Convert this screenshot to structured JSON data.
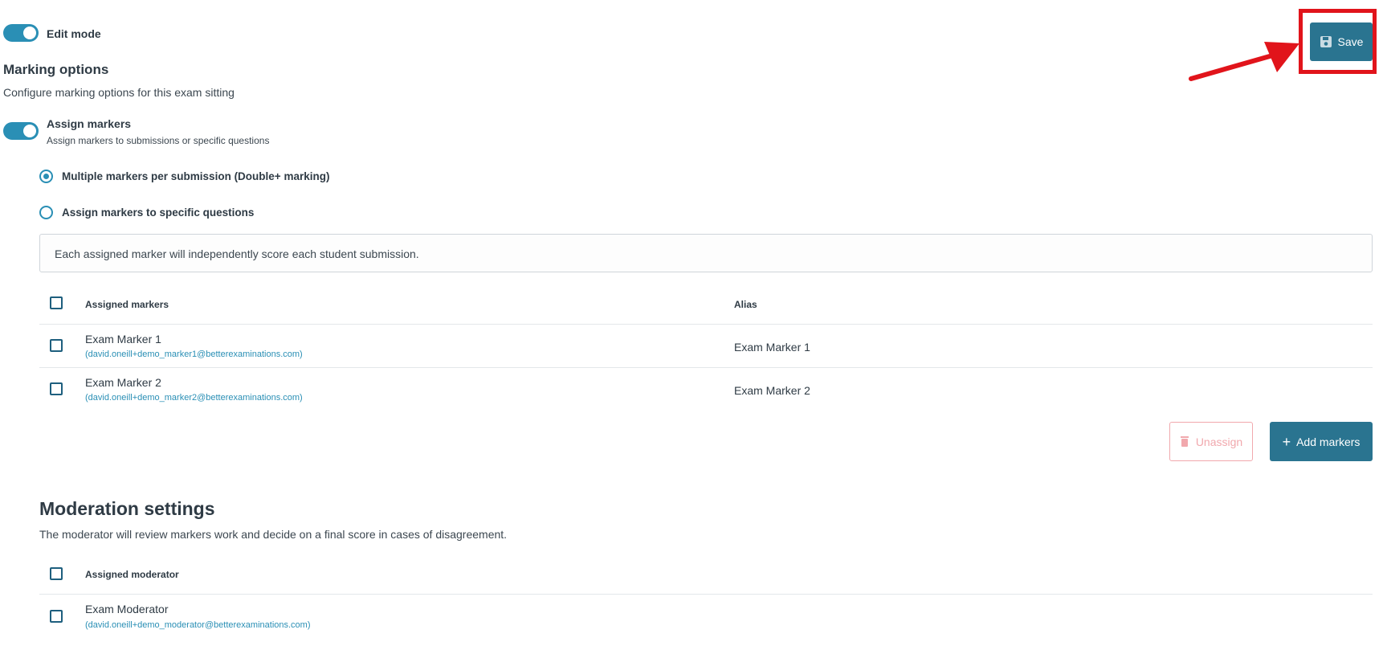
{
  "header": {
    "edit_mode_label": "Edit mode",
    "save_label": "Save"
  },
  "marking": {
    "title": "Marking options",
    "description": "Configure marking options for this exam sitting",
    "assign_label": "Assign markers",
    "assign_description": "Assign markers to submissions or specific questions",
    "radio_multiple": "Multiple markers per submission (Double+ marking)",
    "radio_specific": "Assign markers to specific questions",
    "info_text": "Each assigned marker will independently score each student submission.",
    "table": {
      "col_markers": "Assigned markers",
      "col_alias": "Alias",
      "rows": [
        {
          "name": "Exam Marker 1",
          "email": "(david.oneill+demo_marker1@betterexaminations.com)",
          "alias": "Exam Marker 1"
        },
        {
          "name": "Exam Marker 2",
          "email": "(david.oneill+demo_marker2@betterexaminations.com)",
          "alias": "Exam Marker 2"
        }
      ]
    },
    "unassign_label": "Unassign",
    "add_markers_label": "Add markers"
  },
  "moderation": {
    "title": "Moderation settings",
    "description": "The moderator will review markers work and decide on a final score in cases of disagreement.",
    "col_moderator": "Assigned moderator",
    "rows": [
      {
        "name": "Exam Moderator",
        "email": "(david.oneill+demo_moderator@betterexaminations.com)"
      }
    ]
  },
  "colors": {
    "accent": "#2a8fb5",
    "primary_button": "#2a7490",
    "highlight": "#e1141b"
  }
}
